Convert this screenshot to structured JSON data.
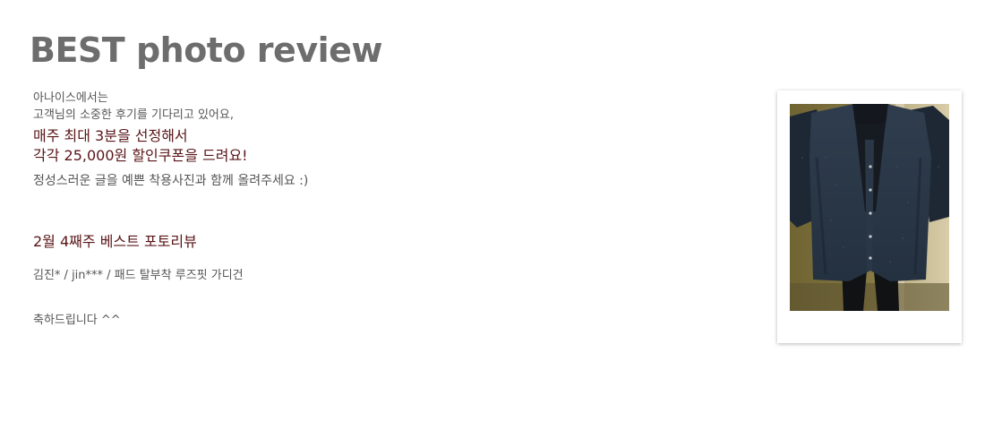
{
  "header": {
    "title": "BEST photo review"
  },
  "intro": {
    "line1": "아나이스에서는",
    "line2": "고객님의 소중한 후기를 기다리고 있어요,",
    "highlight_line1": "매주 최대 3분을 선정해서",
    "highlight_line2": "각각 25,000원 할인쿠폰을 드려요!",
    "line3": "정성스러운 글을 예쁜 착용사진과 함께 올려주세요 :)"
  },
  "weekly": {
    "title": "2월 4째주 베스트 포토리뷰",
    "winners": "김진* / jin*** / 패드 탈부착 루즈핏 가디건",
    "congrats": "축하드립니다 ^^"
  },
  "colors": {
    "title_gray": "#6d6d6d",
    "text_gray": "#555555",
    "accent_maroon": "#5a1518"
  }
}
